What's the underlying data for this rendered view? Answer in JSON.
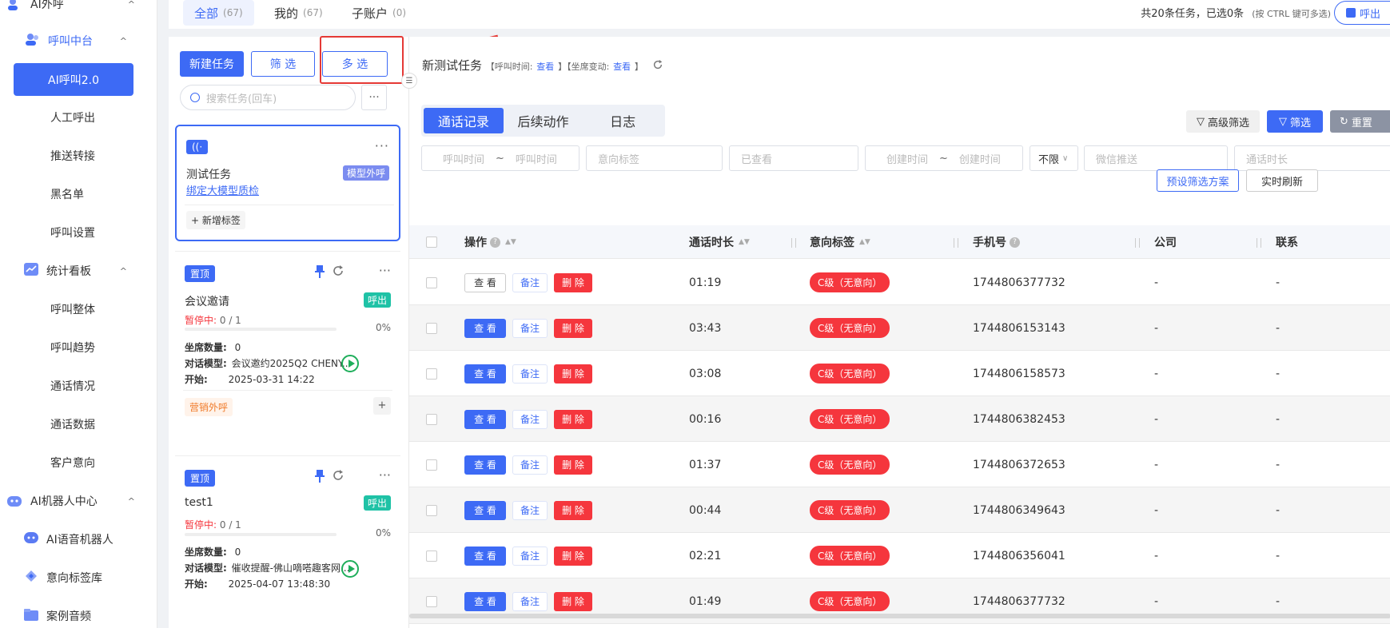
{
  "sidebar": {
    "groups": [
      {
        "label": "AI外呼",
        "chevron": "^",
        "icon": "phone-person-icon"
      },
      {
        "label": "AI机器人中心",
        "chevron": "^",
        "icon": "robot-icon"
      }
    ],
    "subgroups": [
      {
        "label": "呼叫中台",
        "chevron": "^",
        "icon": "users-icon"
      },
      {
        "label": "统计看板",
        "chevron": "^",
        "icon": "chart-icon"
      }
    ],
    "items": [
      {
        "label": "AI呼叫2.0"
      },
      {
        "label": "人工呼出"
      },
      {
        "label": "推送转接"
      },
      {
        "label": "黑名单"
      },
      {
        "label": "呼叫设置"
      },
      {
        "label": "呼叫整体"
      },
      {
        "label": "呼叫趋势"
      },
      {
        "label": "通话情况"
      },
      {
        "label": "通话数据"
      },
      {
        "label": "客户意向"
      }
    ],
    "robot_items": [
      {
        "label": "AI语音机器人",
        "icon": "robot-face-icon"
      },
      {
        "label": "意向标签库",
        "icon": "tag-icon"
      },
      {
        "label": "案例音频",
        "icon": "audio-folder-icon"
      }
    ]
  },
  "topbar": {
    "tabs": [
      {
        "label": "全部",
        "count": "(67)"
      },
      {
        "label": "我的",
        "count": "(67)"
      },
      {
        "label": "子账户",
        "count": "(0)"
      }
    ],
    "summary": "共20条任务，已选0条",
    "summary_hint": "(按 CTRL 键可多选)",
    "outbound_button": "呼出"
  },
  "taskpanel": {
    "new_task": "新建任务",
    "filter": "筛 选",
    "multi_select": "多 选",
    "search_placeholder": "搜索任务(回车)",
    "more": "···",
    "cards": [
      {
        "badge": "((·",
        "title": "测试任务",
        "type_tag": "模型外呼",
        "link": "绑定大模型质检",
        "add_tag": "+ 新增标签"
      },
      {
        "badge": "置顶",
        "title": "会议邀请",
        "type_tag": "呼出",
        "status": "暂停中:",
        "progress_text": "0 / 1",
        "progress_pct": "0%",
        "seats_label": "坐席数量:",
        "seats_value": "0",
        "model_label": "对话模型:",
        "model_value": "会议邀约2025Q2 CHENY...",
        "start_label": "开始:",
        "start_value": "2025-03-31 14:22",
        "footer_tag": "营销外呼",
        "plus": "+"
      },
      {
        "badge": "置顶",
        "title": "test1",
        "type_tag": "呼出",
        "status": "暂停中:",
        "progress_text": "0 / 1",
        "progress_pct": "0%",
        "seats_label": "坐席数量:",
        "seats_value": "0",
        "model_label": "对话模型:",
        "model_value": "催收提醒-佛山嘀嗒趣客网...",
        "start_label": "开始:",
        "start_value": "2025-04-07 13:48:30"
      }
    ]
  },
  "main": {
    "title": "新测试任务",
    "meta1": "【呼叫时间:",
    "meta1_link": "查看",
    "meta2": "】【坐席变动:",
    "meta2_link": "查看",
    "meta_end": "】",
    "subtabs": [
      "通话记录",
      "后续动作",
      "日志"
    ],
    "adv_filter": "高级筛选",
    "filter": "筛选",
    "reset": "重置",
    "filters": {
      "call_time_start": "呼叫时间",
      "tilde1": "~",
      "call_time_end": "呼叫时间",
      "intent_tag": "意向标签",
      "viewed": "已查看",
      "create_start": "创建时间",
      "tilde2": "~",
      "create_end": "创建时间",
      "unlimited": "不限",
      "wechat_push": "微信推送",
      "call_duration": "通话时长"
    },
    "preset": "预设筛选方案",
    "realtime": "实时刷新",
    "columns": [
      "操作",
      "通话时长",
      "意向标签",
      "手机号",
      "公司",
      "联系"
    ],
    "row_actions": {
      "view": "查 看",
      "note": "备注",
      "delete": "删 除"
    },
    "rows": [
      {
        "duration": "01:19",
        "intent": "C级（无意向）",
        "phone": "1744806377732",
        "company": "-",
        "contact": "-"
      },
      {
        "duration": "03:43",
        "intent": "C级（无意向）",
        "phone": "1744806153143",
        "company": "-",
        "contact": "-"
      },
      {
        "duration": "03:08",
        "intent": "C级（无意向）",
        "phone": "1744806158573",
        "company": "-",
        "contact": "-"
      },
      {
        "duration": "00:16",
        "intent": "C级（无意向）",
        "phone": "1744806382453",
        "company": "-",
        "contact": "-"
      },
      {
        "duration": "01:37",
        "intent": "C级（无意向）",
        "phone": "1744806372653",
        "company": "-",
        "contact": "-"
      },
      {
        "duration": "00:44",
        "intent": "C级（无意向）",
        "phone": "1744806349643",
        "company": "-",
        "contact": "-"
      },
      {
        "duration": "02:21",
        "intent": "C级（无意向）",
        "phone": "1744806356041",
        "company": "-",
        "contact": "-"
      },
      {
        "duration": "01:49",
        "intent": "C级（无意向）",
        "phone": "1744806377732",
        "company": "-",
        "contact": "-"
      }
    ]
  },
  "colors": {
    "primary": "#3d6af5",
    "danger": "#f5363d",
    "success": "#1fae5b",
    "teal": "#1fc2a6",
    "annotation_red": "#e53935"
  }
}
